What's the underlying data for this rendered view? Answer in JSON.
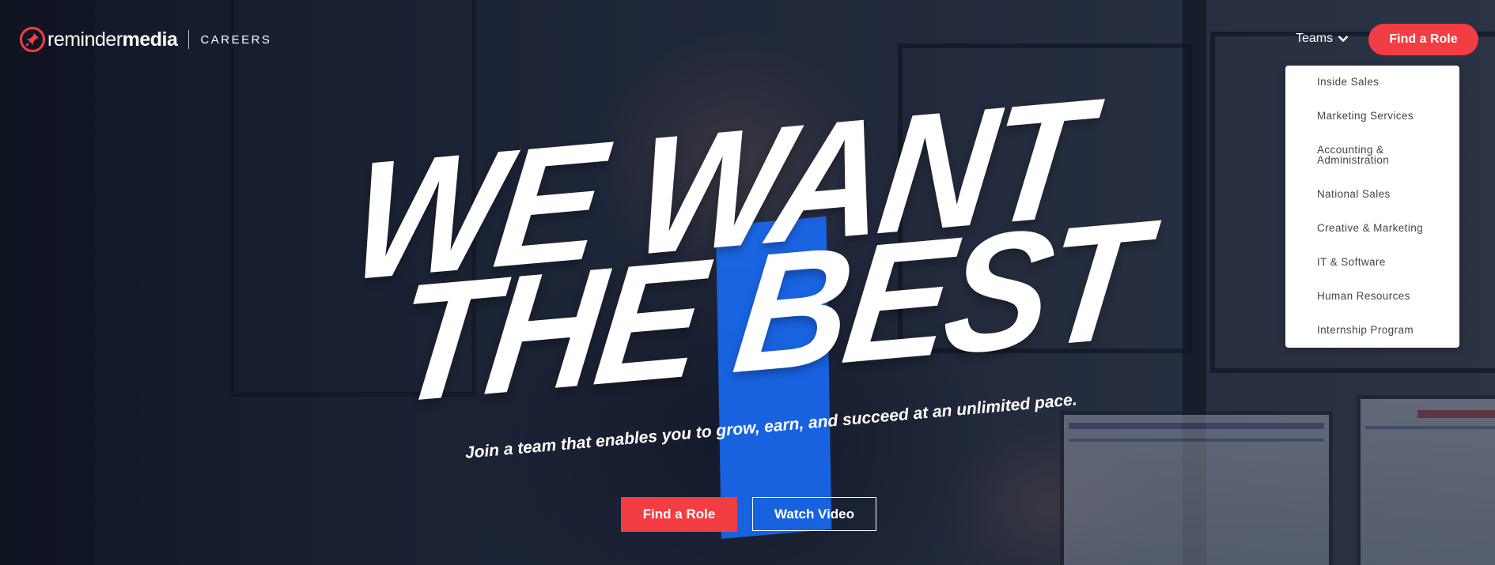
{
  "brand": {
    "logo_light": "reminder",
    "logo_bold": "media",
    "section": "CAREERS",
    "accent_color": "#f23d42",
    "highlight_color": "#1e6eff",
    "logo_icon": "pushpin-icon"
  },
  "nav": {
    "teams_label": "Teams",
    "teams_icon": "chevron-down-icon",
    "cta_label": "Find a Role"
  },
  "teams_menu": {
    "items": [
      {
        "label": "Inside Sales"
      },
      {
        "label": "Marketing Services"
      },
      {
        "label": "Accounting &"
      },
      {
        "label": "Administration"
      },
      {
        "label": "National Sales"
      },
      {
        "label": "Creative & Marketing"
      },
      {
        "label": "IT & Software"
      },
      {
        "label": "Human Resources"
      },
      {
        "label": "Internship Program"
      }
    ]
  },
  "hero": {
    "headline_line1": "WE WANT",
    "headline_line2": "THE BEST",
    "subheadline": "Join a team that enables you to grow, earn, and succeed at an unlimited pace.",
    "primary_button": "Find a Role",
    "secondary_button": "Watch Video"
  }
}
